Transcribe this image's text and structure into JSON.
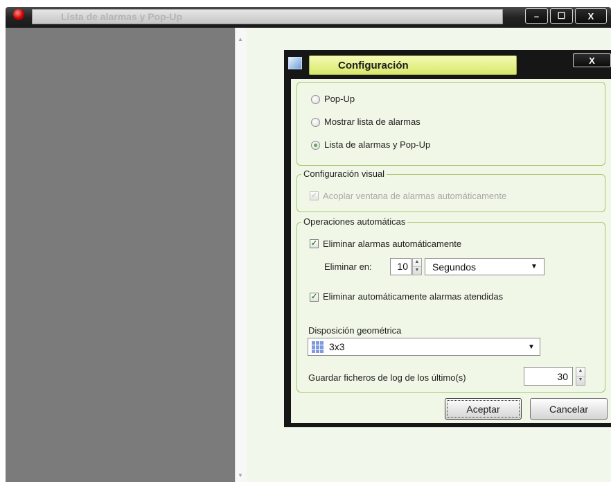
{
  "window": {
    "title": "Lista de alarmas y Pop-Up",
    "minimize_glyph": "–",
    "maximize_glyph": "☐",
    "close_glyph": "X",
    "scroll_up_glyph": "▲",
    "scroll_down_glyph": "▼"
  },
  "dialog": {
    "title": "Configuración",
    "close_glyph": "X",
    "mode_options": [
      {
        "label": "Pop-Up",
        "selected": false
      },
      {
        "label": "Mostrar lista de alarmas",
        "selected": false
      },
      {
        "label": "Lista de alarmas y Pop-Up",
        "selected": true
      }
    ],
    "visual": {
      "legend": "Configuración visual",
      "dock_label": "Acoplar ventana de alarmas automáticamente",
      "dock_checked": true,
      "dock_enabled": false
    },
    "auto": {
      "legend": "Operaciones automáticas",
      "delete_label": "Eliminar alarmas automáticamente",
      "delete_checked": true,
      "delete_in_label": "Eliminar en:",
      "delete_in_value": "10",
      "delete_in_unit": "Segundos",
      "delete_attended_label": "Eliminar automáticamente alarmas atendidas",
      "delete_attended_checked": true,
      "layout_label": "Disposición geométrica",
      "layout_value": "3x3",
      "log_label": "Guardar ficheros de log de los último(s)",
      "log_value": "30"
    },
    "buttons": {
      "accept": "Aceptar",
      "cancel": "Cancelar"
    },
    "glyphs": {
      "check": "✓",
      "spin_up": "▲",
      "spin_down": "▼",
      "dropdown": "▼"
    }
  },
  "colors": {
    "dialog_background": "#f0f7e7",
    "title_highlight": "#e3ef8c",
    "group_border": "#a8c46a",
    "left_panel": "#7b7b7b"
  }
}
